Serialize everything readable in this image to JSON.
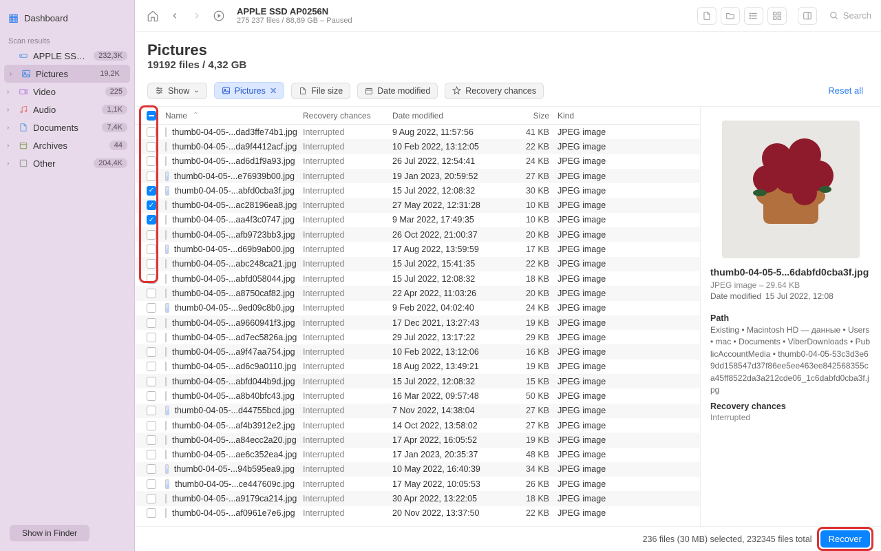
{
  "sidebar": {
    "dashboard": "Dashboard",
    "scan_label": "Scan results",
    "items": [
      {
        "icon": "drive",
        "label": "APPLE SSD AP...",
        "count": "232,3K",
        "chev": ""
      },
      {
        "icon": "pic",
        "label": "Pictures",
        "count": "19,2K",
        "chev": "›",
        "active": true
      },
      {
        "icon": "vid",
        "label": "Video",
        "count": "225",
        "chev": "›"
      },
      {
        "icon": "aud",
        "label": "Audio",
        "count": "1,1K",
        "chev": "›"
      },
      {
        "icon": "doc",
        "label": "Documents",
        "count": "7,4K",
        "chev": "›"
      },
      {
        "icon": "arc",
        "label": "Archives",
        "count": "44",
        "chev": "›"
      },
      {
        "icon": "oth",
        "label": "Other",
        "count": "204,4K",
        "chev": "›"
      }
    ],
    "show_in_finder": "Show in Finder"
  },
  "topbar": {
    "title": "APPLE SSD AP0256N",
    "subtitle": "275 237 files / 88,89 GB – Paused",
    "search_placeholder": "Search"
  },
  "page": {
    "title": "Pictures",
    "subtitle": "19192 files / 4,32 GB"
  },
  "filters": {
    "show": "Show",
    "pictures": "Pictures",
    "filesize": "File size",
    "datemod": "Date modified",
    "recovery": "Recovery chances",
    "reset": "Reset all"
  },
  "columns": {
    "name": "Name",
    "rec": "Recovery chances",
    "date": "Date modified",
    "size": "Size",
    "kind": "Kind"
  },
  "rows": [
    {
      "chk": false,
      "name": "thumb0-04-05-...dad3ffe74b1.jpg",
      "rec": "Interrupted",
      "date": "9 Aug 2022, 11:57:56",
      "size": "41 KB",
      "kind": "JPEG image"
    },
    {
      "chk": false,
      "name": "thumb0-04-05-...da9f4412acf.jpg",
      "rec": "Interrupted",
      "date": "10 Feb 2022, 13:12:05",
      "size": "22 KB",
      "kind": "JPEG image"
    },
    {
      "chk": false,
      "name": "thumb0-04-05-...ad6d1f9a93.jpg",
      "rec": "Interrupted",
      "date": "26 Jul 2022, 12:54:41",
      "size": "24 KB",
      "kind": "JPEG image"
    },
    {
      "chk": false,
      "name": "thumb0-04-05-...e76939b00.jpg",
      "rec": "Interrupted",
      "date": "19 Jan 2023, 20:59:52",
      "size": "27 KB",
      "kind": "JPEG image"
    },
    {
      "chk": true,
      "name": "thumb0-04-05-...abfd0cba3f.jpg",
      "rec": "Interrupted",
      "date": "15 Jul 2022, 12:08:32",
      "size": "30 KB",
      "kind": "JPEG image"
    },
    {
      "chk": true,
      "name": "thumb0-04-05-...ac28196ea8.jpg",
      "rec": "Interrupted",
      "date": "27 May 2022, 12:31:28",
      "size": "10 KB",
      "kind": "JPEG image"
    },
    {
      "chk": true,
      "name": "thumb0-04-05-...aa4f3c0747.jpg",
      "rec": "Interrupted",
      "date": "9 Mar 2022, 17:49:35",
      "size": "10 KB",
      "kind": "JPEG image"
    },
    {
      "chk": false,
      "name": "thumb0-04-05-...afb9723bb3.jpg",
      "rec": "Interrupted",
      "date": "26 Oct 2022, 21:00:37",
      "size": "20 KB",
      "kind": "JPEG image"
    },
    {
      "chk": false,
      "name": "thumb0-04-05-...d69b9ab00.jpg",
      "rec": "Interrupted",
      "date": "17 Aug 2022, 13:59:59",
      "size": "17 KB",
      "kind": "JPEG image"
    },
    {
      "chk": false,
      "name": "thumb0-04-05-...abc248ca21.jpg",
      "rec": "Interrupted",
      "date": "15 Jul 2022, 15:41:35",
      "size": "22 KB",
      "kind": "JPEG image"
    },
    {
      "chk": false,
      "name": "thumb0-04-05-...abfd058044.jpg",
      "rec": "Interrupted",
      "date": "15 Jul 2022, 12:08:32",
      "size": "18 KB",
      "kind": "JPEG image"
    },
    {
      "chk": false,
      "name": "thumb0-04-05-...a8750caf82.jpg",
      "rec": "Interrupted",
      "date": "22 Apr 2022, 11:03:26",
      "size": "20 KB",
      "kind": "JPEG image"
    },
    {
      "chk": false,
      "name": "thumb0-04-05-...9ed09c8b0.jpg",
      "rec": "Interrupted",
      "date": "9 Feb 2022, 04:02:40",
      "size": "24 KB",
      "kind": "JPEG image"
    },
    {
      "chk": false,
      "name": "thumb0-04-05-...a9660941f3.jpg",
      "rec": "Interrupted",
      "date": "17 Dec 2021, 13:27:43",
      "size": "19 KB",
      "kind": "JPEG image"
    },
    {
      "chk": false,
      "name": "thumb0-04-05-...ad7ec5826a.jpg",
      "rec": "Interrupted",
      "date": "29 Jul 2022, 13:17:22",
      "size": "29 KB",
      "kind": "JPEG image"
    },
    {
      "chk": false,
      "name": "thumb0-04-05-...a9f47aa754.jpg",
      "rec": "Interrupted",
      "date": "10 Feb 2022, 13:12:06",
      "size": "16 KB",
      "kind": "JPEG image"
    },
    {
      "chk": false,
      "name": "thumb0-04-05-...ad6c9a0110.jpg",
      "rec": "Interrupted",
      "date": "18 Aug 2022, 13:49:21",
      "size": "19 KB",
      "kind": "JPEG image"
    },
    {
      "chk": false,
      "name": "thumb0-04-05-...abfd044b9d.jpg",
      "rec": "Interrupted",
      "date": "15 Jul 2022, 12:08:32",
      "size": "15 KB",
      "kind": "JPEG image"
    },
    {
      "chk": false,
      "name": "thumb0-04-05-...a8b40bfc43.jpg",
      "rec": "Interrupted",
      "date": "16 Mar 2022, 09:57:48",
      "size": "50 KB",
      "kind": "JPEG image"
    },
    {
      "chk": false,
      "name": "thumb0-04-05-...d44755bcd.jpg",
      "rec": "Interrupted",
      "date": "7 Nov 2022, 14:38:04",
      "size": "27 KB",
      "kind": "JPEG image"
    },
    {
      "chk": false,
      "name": "thumb0-04-05-...af4b3912e2.jpg",
      "rec": "Interrupted",
      "date": "14 Oct 2022, 13:58:02",
      "size": "27 KB",
      "kind": "JPEG image"
    },
    {
      "chk": false,
      "name": "thumb0-04-05-...a84ecc2a20.jpg",
      "rec": "Interrupted",
      "date": "17 Apr 2022, 16:05:52",
      "size": "19 KB",
      "kind": "JPEG image"
    },
    {
      "chk": false,
      "name": "thumb0-04-05-...ae6c352ea4.jpg",
      "rec": "Interrupted",
      "date": "17 Jan 2023, 20:35:37",
      "size": "48 KB",
      "kind": "JPEG image"
    },
    {
      "chk": false,
      "name": "thumb0-04-05-...94b595ea9.jpg",
      "rec": "Interrupted",
      "date": "10 May 2022, 16:40:39",
      "size": "34 KB",
      "kind": "JPEG image"
    },
    {
      "chk": false,
      "name": "thumb0-04-05-...ce447609c.jpg",
      "rec": "Interrupted",
      "date": "17 May 2022, 10:05:53",
      "size": "26 KB",
      "kind": "JPEG image"
    },
    {
      "chk": false,
      "name": "thumb0-04-05-...a9179ca214.jpg",
      "rec": "Interrupted",
      "date": "30 Apr 2022, 13:22:05",
      "size": "18 KB",
      "kind": "JPEG image"
    },
    {
      "chk": false,
      "name": "thumb0-04-05-...af0961e7e6.jpg",
      "rec": "Interrupted",
      "date": "20 Nov 2022, 13:37:50",
      "size": "22 KB",
      "kind": "JPEG image"
    }
  ],
  "preview": {
    "title": "thumb0-04-05-5...6dabfd0cba3f.jpg",
    "sub": "JPEG image – 29.64 KB",
    "date_label": "Date modified",
    "date_val": "15 Jul 2022, 12:08",
    "path_label": "Path",
    "path": "Existing • Macintosh HD — данные • Users • mac • Documents • ViberDownloads • PublicAccountMedia • thumb0-04-05-53c3d3e69dd158547d37f86ee5ee463ee842568355ca45ff8522da3a212cde06_1c6dabfd0cba3f.jpg",
    "rec_label": "Recovery chances",
    "rec_val": "Interrupted"
  },
  "status": {
    "text": "236 files (30 MB) selected, 232345 files total",
    "recover": "Recover"
  }
}
